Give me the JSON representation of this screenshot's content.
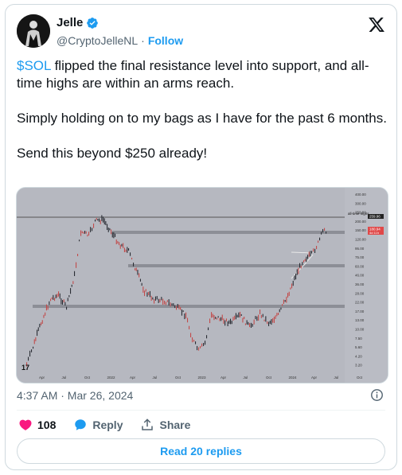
{
  "author": {
    "name": "Jelle",
    "handle": "@CryptoJelleNL",
    "separator": "·",
    "follow_label": "Follow"
  },
  "tweet": {
    "cashtag": "$SOL",
    "line1_rest": " flipped the final resistance level into support, and all-time highs are within an arms reach.",
    "line2": "Simply holding on to my bags as I have for the past 6 months.",
    "line3": "Send this beyond $250 already!"
  },
  "media": {
    "y_axis_labels": [
      "400.00",
      "300.00",
      "250.00",
      "200.00",
      "150.00",
      "120.00",
      "95.00",
      "75.00",
      "60.00",
      "46.00",
      "36.00",
      "28.00",
      "22.00",
      "17.00",
      "13.00",
      "10.00",
      "7.50",
      "5.60",
      "4.20",
      "3.20"
    ],
    "x_axis_labels": [
      "Apr",
      "Jul",
      "Oct",
      "2022",
      "Apr",
      "Jul",
      "Oct",
      "2023",
      "Apr",
      "Jul",
      "Oct",
      "2024",
      "Apr",
      "Jul",
      "Oct"
    ],
    "ath_label": "all-time highs",
    "ath_value": "259.96",
    "price_value": "180.94",
    "price_sub": "4d 11h",
    "watermark": "17"
  },
  "meta": {
    "timestamp": "4:37 AM · Mar 26, 2024"
  },
  "actions": {
    "like_count": "108",
    "reply_label": "Reply",
    "share_label": "Share"
  },
  "replies_button": "Read 20 replies",
  "colors": {
    "accent": "#1d9bf0",
    "like": "#f91880",
    "chart_bg": "#b6b8c0",
    "up_candle": "#2a2d34",
    "down_candle": "#c24b4b"
  }
}
